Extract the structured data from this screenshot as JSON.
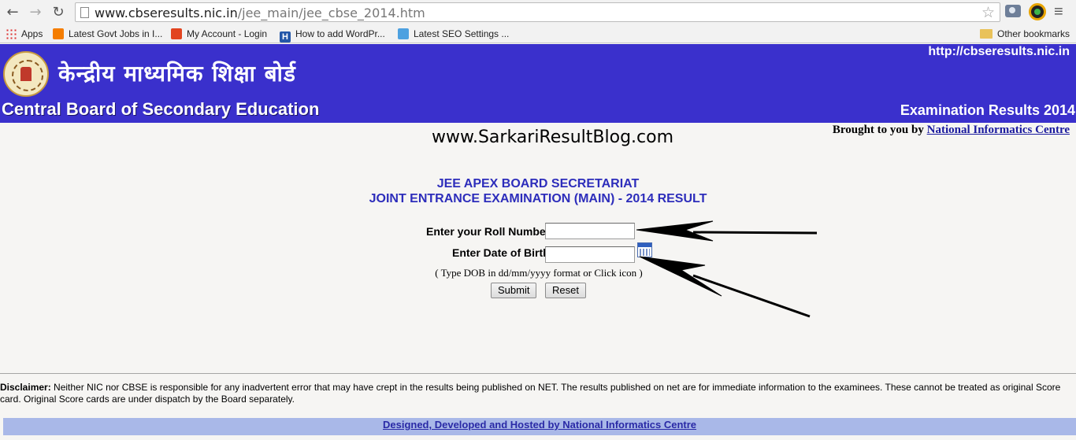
{
  "browser": {
    "url_host": "www.cbseresults.nic.in",
    "url_path": "/jee_main/jee_cbse_2014.htm",
    "bookmarks": [
      {
        "label": "Apps",
        "icon": "apps-icon"
      },
      {
        "label": "Latest Govt Jobs in I...",
        "icon": "blogger-icon"
      },
      {
        "label": "My Account - Login",
        "icon": "my-account-icon"
      },
      {
        "label": "How to add WordPr...",
        "icon": "h-icon"
      },
      {
        "label": "Latest SEO Settings ...",
        "icon": "blogger-icon"
      }
    ],
    "other_bookmarks": "Other bookmarks"
  },
  "header": {
    "hindi_title": "केन्द्रीय माध्यमिक शिक्षा बोर्ड",
    "site_url": "http://cbseresults.nic.in",
    "board_name": "Central Board of Secondary Education",
    "exam_results": "Examination Results 2014"
  },
  "brought_by": {
    "prefix": "Brought to you by",
    "link": "National Informatics Centre"
  },
  "watermark": "www.SarkariResultBlog.com",
  "title": {
    "line1": "JEE APEX BOARD SECRETARIAT",
    "line2": "JOINT ENTRANCE EXAMINATION (MAIN) - 2014 RESULT"
  },
  "form": {
    "roll_label": "Enter your Roll Number",
    "roll_value": "",
    "dob_label": "Enter Date of Birth",
    "dob_value": "",
    "dob_hint": "( Type DOB in dd/mm/yyyy format or Click icon )",
    "submit": "Submit",
    "reset": "Reset"
  },
  "disclaimer": {
    "label": "Disclaimer:",
    "text": "Neither NIC nor CBSE is responsible for any inadvertent error that may have crept in the results being published on NET. The results published on net are for immediate information to the examinees. These cannot be treated as original Score card. Original Score cards are under dispatch by the Board separately."
  },
  "footer": {
    "link": "Designed, Developed and Hosted by National Informatics Centre"
  }
}
